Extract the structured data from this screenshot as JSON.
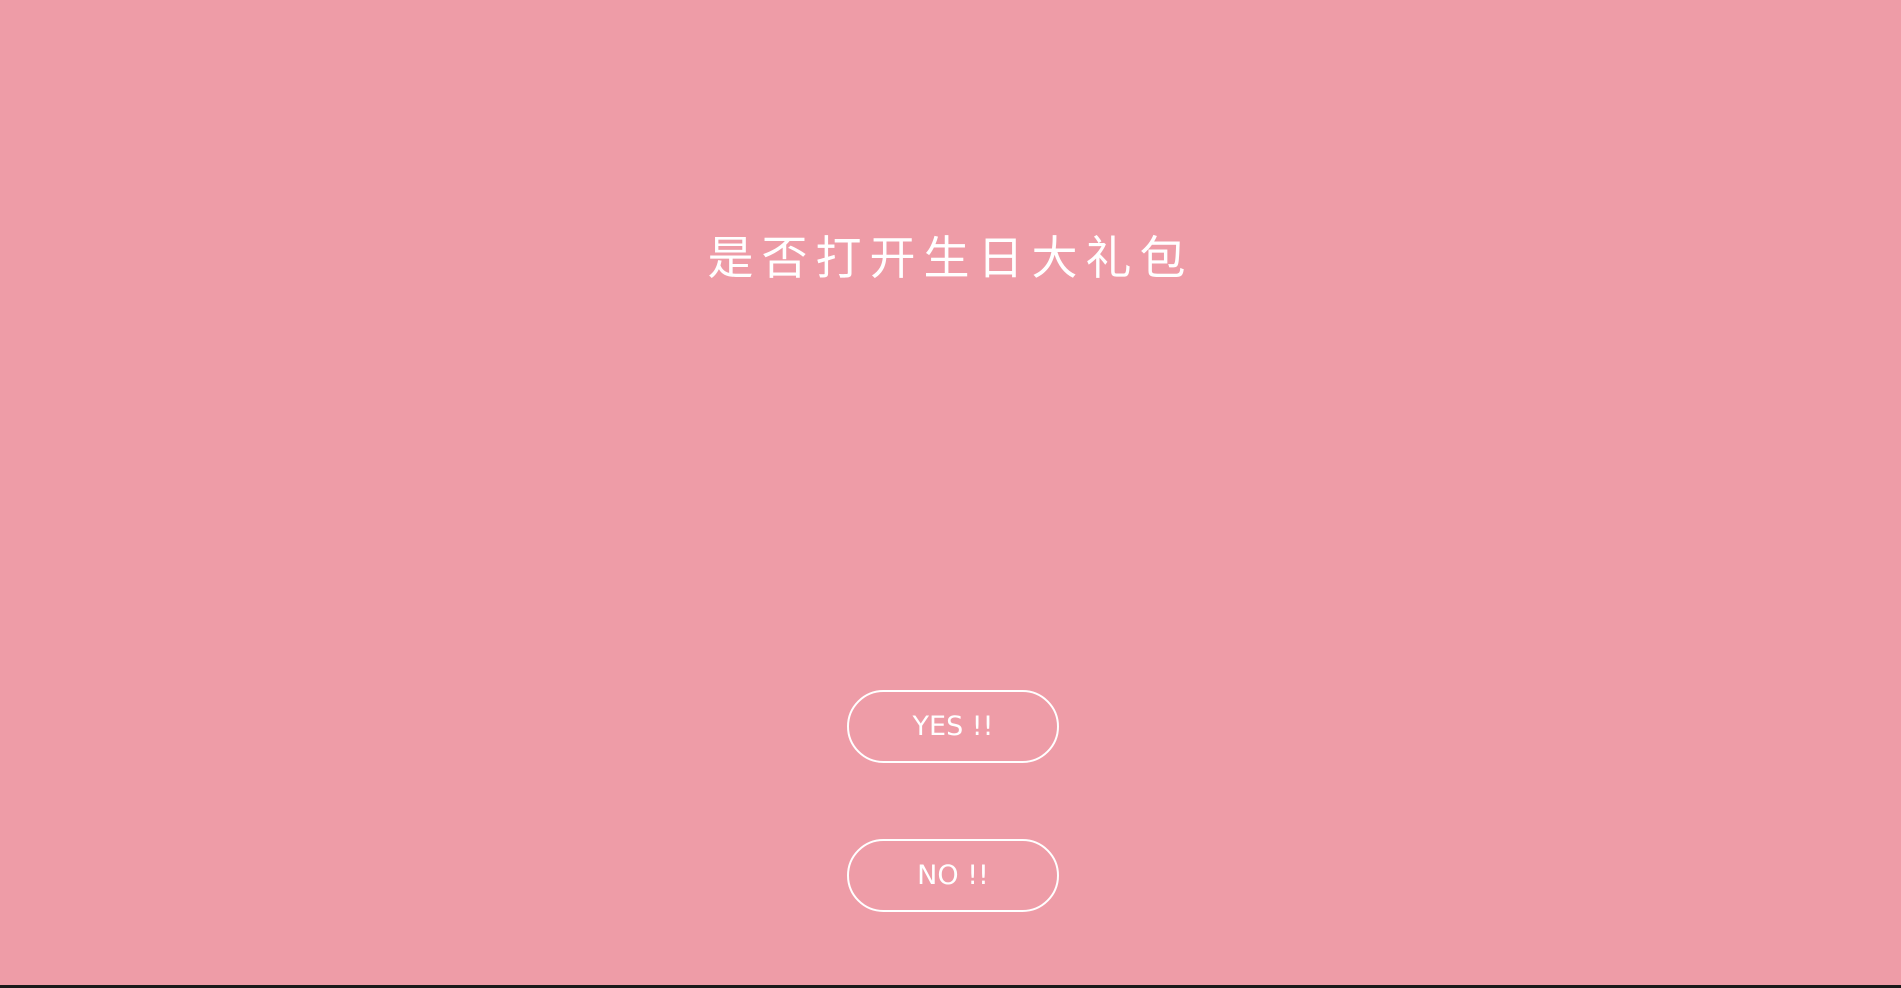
{
  "page": {
    "background_color": "#ee9ca7",
    "text_color": "#ffffff"
  },
  "prompt": {
    "title": "是否打开生日大礼包"
  },
  "actions": {
    "yes_label": "YES !!",
    "no_label": "NO !!"
  }
}
